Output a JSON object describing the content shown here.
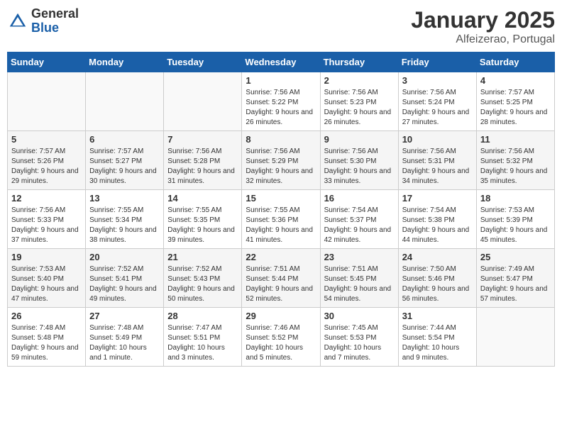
{
  "logo": {
    "general": "General",
    "blue": "Blue"
  },
  "calendar": {
    "title": "January 2025",
    "subtitle": "Alfeizerao, Portugal"
  },
  "headers": [
    "Sunday",
    "Monday",
    "Tuesday",
    "Wednesday",
    "Thursday",
    "Friday",
    "Saturday"
  ],
  "weeks": [
    [
      {
        "day": "",
        "info": ""
      },
      {
        "day": "",
        "info": ""
      },
      {
        "day": "",
        "info": ""
      },
      {
        "day": "1",
        "info": "Sunrise: 7:56 AM\nSunset: 5:22 PM\nDaylight: 9 hours and 26 minutes."
      },
      {
        "day": "2",
        "info": "Sunrise: 7:56 AM\nSunset: 5:23 PM\nDaylight: 9 hours and 26 minutes."
      },
      {
        "day": "3",
        "info": "Sunrise: 7:56 AM\nSunset: 5:24 PM\nDaylight: 9 hours and 27 minutes."
      },
      {
        "day": "4",
        "info": "Sunrise: 7:57 AM\nSunset: 5:25 PM\nDaylight: 9 hours and 28 minutes."
      }
    ],
    [
      {
        "day": "5",
        "info": "Sunrise: 7:57 AM\nSunset: 5:26 PM\nDaylight: 9 hours and 29 minutes."
      },
      {
        "day": "6",
        "info": "Sunrise: 7:57 AM\nSunset: 5:27 PM\nDaylight: 9 hours and 30 minutes."
      },
      {
        "day": "7",
        "info": "Sunrise: 7:56 AM\nSunset: 5:28 PM\nDaylight: 9 hours and 31 minutes."
      },
      {
        "day": "8",
        "info": "Sunrise: 7:56 AM\nSunset: 5:29 PM\nDaylight: 9 hours and 32 minutes."
      },
      {
        "day": "9",
        "info": "Sunrise: 7:56 AM\nSunset: 5:30 PM\nDaylight: 9 hours and 33 minutes."
      },
      {
        "day": "10",
        "info": "Sunrise: 7:56 AM\nSunset: 5:31 PM\nDaylight: 9 hours and 34 minutes."
      },
      {
        "day": "11",
        "info": "Sunrise: 7:56 AM\nSunset: 5:32 PM\nDaylight: 9 hours and 35 minutes."
      }
    ],
    [
      {
        "day": "12",
        "info": "Sunrise: 7:56 AM\nSunset: 5:33 PM\nDaylight: 9 hours and 37 minutes."
      },
      {
        "day": "13",
        "info": "Sunrise: 7:55 AM\nSunset: 5:34 PM\nDaylight: 9 hours and 38 minutes."
      },
      {
        "day": "14",
        "info": "Sunrise: 7:55 AM\nSunset: 5:35 PM\nDaylight: 9 hours and 39 minutes."
      },
      {
        "day": "15",
        "info": "Sunrise: 7:55 AM\nSunset: 5:36 PM\nDaylight: 9 hours and 41 minutes."
      },
      {
        "day": "16",
        "info": "Sunrise: 7:54 AM\nSunset: 5:37 PM\nDaylight: 9 hours and 42 minutes."
      },
      {
        "day": "17",
        "info": "Sunrise: 7:54 AM\nSunset: 5:38 PM\nDaylight: 9 hours and 44 minutes."
      },
      {
        "day": "18",
        "info": "Sunrise: 7:53 AM\nSunset: 5:39 PM\nDaylight: 9 hours and 45 minutes."
      }
    ],
    [
      {
        "day": "19",
        "info": "Sunrise: 7:53 AM\nSunset: 5:40 PM\nDaylight: 9 hours and 47 minutes."
      },
      {
        "day": "20",
        "info": "Sunrise: 7:52 AM\nSunset: 5:41 PM\nDaylight: 9 hours and 49 minutes."
      },
      {
        "day": "21",
        "info": "Sunrise: 7:52 AM\nSunset: 5:43 PM\nDaylight: 9 hours and 50 minutes."
      },
      {
        "day": "22",
        "info": "Sunrise: 7:51 AM\nSunset: 5:44 PM\nDaylight: 9 hours and 52 minutes."
      },
      {
        "day": "23",
        "info": "Sunrise: 7:51 AM\nSunset: 5:45 PM\nDaylight: 9 hours and 54 minutes."
      },
      {
        "day": "24",
        "info": "Sunrise: 7:50 AM\nSunset: 5:46 PM\nDaylight: 9 hours and 56 minutes."
      },
      {
        "day": "25",
        "info": "Sunrise: 7:49 AM\nSunset: 5:47 PM\nDaylight: 9 hours and 57 minutes."
      }
    ],
    [
      {
        "day": "26",
        "info": "Sunrise: 7:48 AM\nSunset: 5:48 PM\nDaylight: 9 hours and 59 minutes."
      },
      {
        "day": "27",
        "info": "Sunrise: 7:48 AM\nSunset: 5:49 PM\nDaylight: 10 hours and 1 minute."
      },
      {
        "day": "28",
        "info": "Sunrise: 7:47 AM\nSunset: 5:51 PM\nDaylight: 10 hours and 3 minutes."
      },
      {
        "day": "29",
        "info": "Sunrise: 7:46 AM\nSunset: 5:52 PM\nDaylight: 10 hours and 5 minutes."
      },
      {
        "day": "30",
        "info": "Sunrise: 7:45 AM\nSunset: 5:53 PM\nDaylight: 10 hours and 7 minutes."
      },
      {
        "day": "31",
        "info": "Sunrise: 7:44 AM\nSunset: 5:54 PM\nDaylight: 10 hours and 9 minutes."
      },
      {
        "day": "",
        "info": ""
      }
    ]
  ]
}
